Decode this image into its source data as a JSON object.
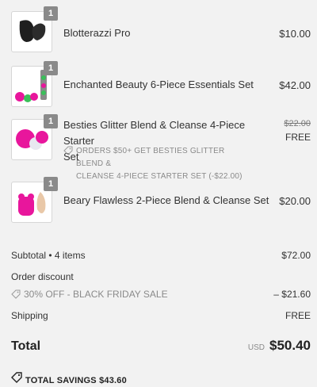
{
  "items": [
    {
      "name": "Blotterazzi Pro",
      "qty": "1",
      "price": "$10.00",
      "image_icon": "black-sponge-icon"
    },
    {
      "name": "Enchanted Beauty 6-Piece Essentials Set",
      "qty": "1",
      "price": "$42.00",
      "image_icon": "sponge-set-icon"
    },
    {
      "name_line1": "Besties Glitter Blend & Cleanse 4-Piece Starter",
      "name_line2": "Set",
      "qty": "1",
      "original_price": "$22.00",
      "price": "FREE",
      "promo_line1": "ORDERS $50+ GET BESTIES GLITTER BLEND &",
      "promo_line2": "CLEANSE 4-PIECE STARTER SET (-$22.00)",
      "image_icon": "glitter-sponge-icon"
    },
    {
      "name": "Beary Flawless 2-Piece Blend & Cleanse Set",
      "qty": "1",
      "price": "$20.00",
      "image_icon": "bear-sponge-icon"
    }
  ],
  "summary": {
    "subtotal_label": "Subtotal • 4 items",
    "subtotal_value": "$72.00",
    "order_discount_label": "Order discount",
    "discount_name": "30% OFF - BLACK FRIDAY SALE",
    "discount_value": "– $21.60",
    "shipping_label": "Shipping",
    "shipping_value": "FREE",
    "total_label": "Total",
    "total_currency": "USD",
    "total_value": "$50.40",
    "savings_label": "TOTAL SAVINGS",
    "savings_value": "$43.60"
  },
  "colors": {
    "background": "#f2f2f2",
    "badge": "#8a8a8a",
    "accent_pink": "#e8169c"
  }
}
